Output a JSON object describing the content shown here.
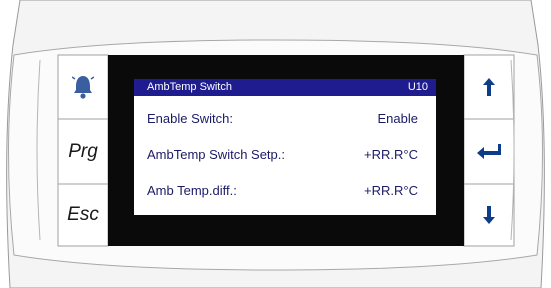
{
  "display": {
    "title": "AmbTemp Switch",
    "screen_code": "U10",
    "rows": [
      {
        "label": "Enable Switch:",
        "value": "Enable"
      },
      {
        "label": "AmbTemp Switch Setp.:",
        "value": "+RR.R°C"
      },
      {
        "label": "Amb Temp.diff.:",
        "value": "+RR.R°C"
      }
    ]
  },
  "keys": {
    "prg_label": "Prg",
    "esc_label": "Esc",
    "alarm_icon": "bell-icon",
    "up_icon": "arrow-up-icon",
    "enter_icon": "enter-icon",
    "down_icon": "arrow-down-icon"
  },
  "colors": {
    "title_bar": "#1e1c8f",
    "text": "#1b1b66",
    "alarm_icon": "#3a5fa0",
    "arrow_icon": "#0d3d8a"
  }
}
